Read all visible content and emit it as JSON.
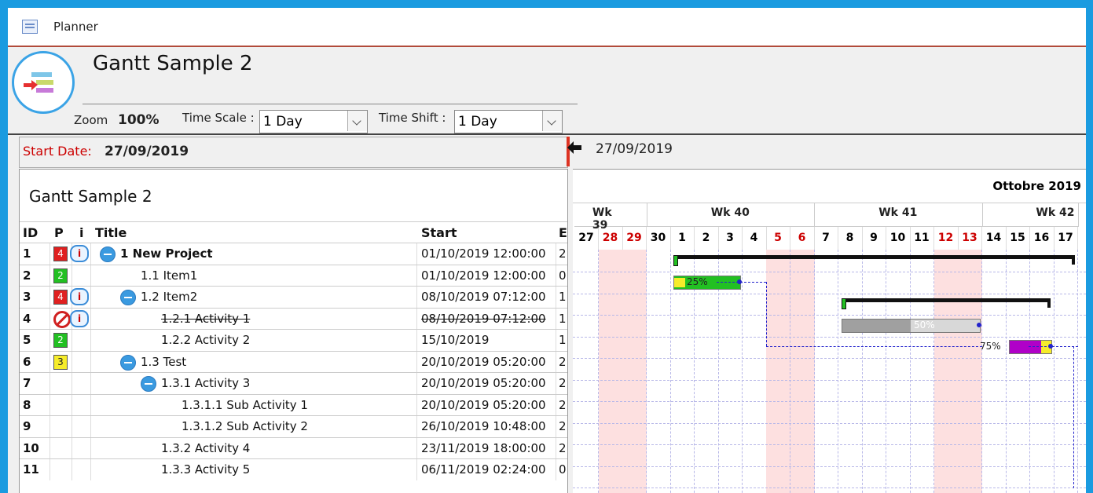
{
  "window": {
    "title": "Planner"
  },
  "header": {
    "title": "Gantt Sample 2",
    "zoom_label": "Zoom",
    "zoom_value": "100%",
    "timescale_label": "Time Scale :",
    "timescale_value": "1 Day",
    "timeshift_label": "Time Shift :",
    "timeshift_value": "1 Day"
  },
  "startbar": {
    "label": "Start Date:",
    "value": "27/09/2019"
  },
  "goto": {
    "date": "27/09/2019"
  },
  "grid": {
    "title": "Gantt Sample 2",
    "columns": [
      "ID",
      "P",
      "i",
      "Title",
      "Start",
      "E"
    ],
    "rows": [
      {
        "id": "1",
        "priority": "4",
        "pcolor": "red",
        "info": true,
        "collapse": true,
        "indent": 0,
        "title": "1 New Project",
        "bold": true,
        "start": "01/10/2019 12:00:00",
        "end": "2",
        "strike": false
      },
      {
        "id": "2",
        "priority": "2",
        "pcolor": "green",
        "info": false,
        "collapse": false,
        "indent": 1,
        "title": "1.1 Item1",
        "bold": false,
        "start": "01/10/2019 12:00:00",
        "end": "0",
        "strike": false
      },
      {
        "id": "3",
        "priority": "4",
        "pcolor": "red",
        "info": true,
        "collapse": true,
        "indent": 1,
        "title": "1.2 Item2",
        "bold": false,
        "start": "08/10/2019 07:12:00",
        "end": "1",
        "strike": false
      },
      {
        "id": "4",
        "priority": "",
        "pcolor": "none",
        "info": true,
        "collapse": false,
        "indent": 2,
        "title": "1.2.1 Activity 1",
        "bold": false,
        "start": "08/10/2019 07:12:00",
        "end": "1",
        "strike": true
      },
      {
        "id": "5",
        "priority": "2",
        "pcolor": "green",
        "info": false,
        "collapse": false,
        "indent": 2,
        "title": "1.2.2 Activity 2",
        "bold": false,
        "start": "15/10/2019",
        "end": "1",
        "strike": false
      },
      {
        "id": "6",
        "priority": "3",
        "pcolor": "yellow",
        "info": false,
        "collapse": true,
        "indent": 1,
        "title": "1.3 Test",
        "bold": false,
        "start": "20/10/2019 05:20:00",
        "end": "2",
        "strike": false
      },
      {
        "id": "7",
        "priority": "",
        "pcolor": "",
        "info": false,
        "collapse": true,
        "indent": 2,
        "title": "1.3.1 Activity 3",
        "bold": false,
        "start": "20/10/2019 05:20:00",
        "end": "2",
        "strike": false
      },
      {
        "id": "8",
        "priority": "",
        "pcolor": "",
        "info": false,
        "collapse": false,
        "indent": 3,
        "title": "1.3.1.1 Sub Activity 1",
        "bold": false,
        "start": "20/10/2019 05:20:00",
        "end": "2",
        "strike": false
      },
      {
        "id": "9",
        "priority": "",
        "pcolor": "",
        "info": false,
        "collapse": false,
        "indent": 3,
        "title": "1.3.1.2 Sub Activity 2",
        "bold": false,
        "start": "26/10/2019 10:48:00",
        "end": "2",
        "strike": false
      },
      {
        "id": "10",
        "priority": "",
        "pcolor": "",
        "info": false,
        "collapse": false,
        "indent": 2,
        "title": "1.3.2 Activity 4",
        "bold": false,
        "start": "23/11/2019 18:00:00",
        "end": "2",
        "strike": false
      },
      {
        "id": "11",
        "priority": "",
        "pcolor": "",
        "info": false,
        "collapse": false,
        "indent": 2,
        "title": "1.3.3 Activity 5",
        "bold": false,
        "start": "06/11/2019 02:24:00",
        "end": "0",
        "strike": false
      }
    ]
  },
  "gantt": {
    "month": "Ottobre 2019",
    "weeks": [
      "Wk 39",
      "Wk 40",
      "Wk 41",
      "Wk 42"
    ],
    "days": [
      "27",
      "28",
      "29",
      "30",
      "1",
      "2",
      "3",
      "4",
      "5",
      "6",
      "7",
      "8",
      "9",
      "10",
      "11",
      "12",
      "13",
      "14",
      "15",
      "16",
      "17"
    ],
    "weekend_days": [
      "28",
      "29",
      "5",
      "6",
      "12",
      "13"
    ],
    "colors": {
      "weekend": "#fde0e0",
      "weekend_text": "#cc0000",
      "summary": "#111111",
      "green_bar": "#22c022",
      "gray_bar": "#a0a0a0",
      "purple_bar": "#b000c8",
      "progress_yellow": "#f6ec2a",
      "link": "#2222cc"
    },
    "bars": [
      {
        "row": 0,
        "type": "summary",
        "start_day": "1",
        "end_day": "17",
        "label": ""
      },
      {
        "row": 1,
        "type": "task",
        "start_day": "1",
        "end_day": "3",
        "progress": 0.25,
        "label": "25%",
        "color": "green"
      },
      {
        "row": 2,
        "type": "summary",
        "start_day": "8",
        "end_day": "16",
        "label": ""
      },
      {
        "row": 3,
        "type": "task",
        "start_day": "8",
        "end_day": "13",
        "progress": 0.5,
        "label": "50%",
        "color": "gray"
      },
      {
        "row": 4,
        "type": "task",
        "start_day": "15",
        "end_day": "16",
        "progress": 0.75,
        "label": "75%",
        "color": "purple"
      }
    ]
  }
}
